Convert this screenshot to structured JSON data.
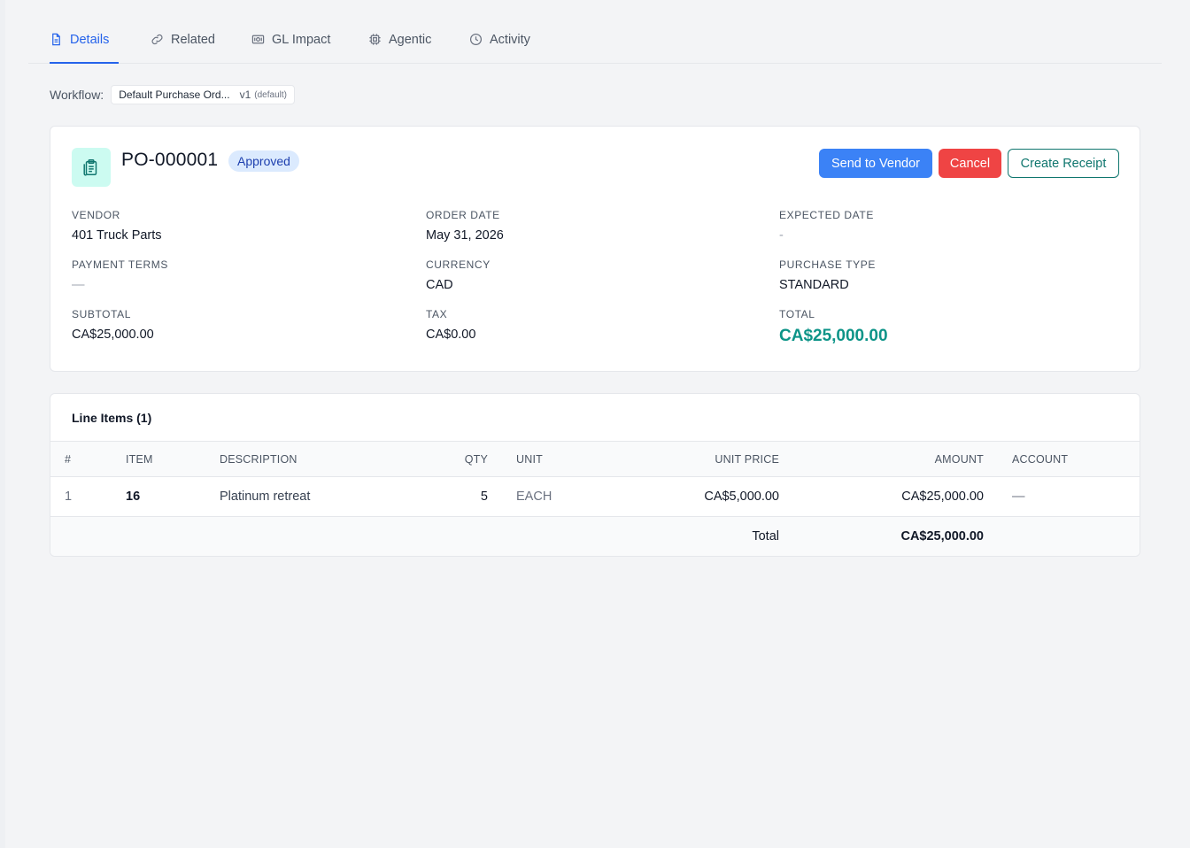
{
  "tabs": [
    {
      "label": "Details",
      "icon": "document-icon",
      "active": true
    },
    {
      "label": "Related",
      "icon": "link-icon",
      "active": false
    },
    {
      "label": "GL Impact",
      "icon": "banknote-icon",
      "active": false
    },
    {
      "label": "Agentic",
      "icon": "chip-icon",
      "active": false
    },
    {
      "label": "Activity",
      "icon": "clock-icon",
      "active": false
    }
  ],
  "workflow": {
    "label": "Workflow:",
    "name": "Default Purchase Ord...",
    "version": "v1",
    "default_tag": "(default)"
  },
  "po": {
    "number": "PO-000001",
    "status": "Approved",
    "icon": "clipboard-icon",
    "actions": {
      "send": "Send to Vendor",
      "cancel": "Cancel",
      "receipt": "Create Receipt"
    },
    "fields": {
      "vendor": {
        "label": "VENDOR",
        "value": "401 Truck Parts"
      },
      "order_date": {
        "label": "ORDER DATE",
        "value": "May 31, 2026"
      },
      "expected_date": {
        "label": "EXPECTED DATE",
        "value": "-"
      },
      "payment_terms": {
        "label": "PAYMENT TERMS",
        "value": "—"
      },
      "currency": {
        "label": "CURRENCY",
        "value": "CAD"
      },
      "purchase_type": {
        "label": "PURCHASE TYPE",
        "value": "STANDARD"
      },
      "subtotal": {
        "label": "SUBTOTAL",
        "value": "CA$25,000.00"
      },
      "tax": {
        "label": "TAX",
        "value": "CA$0.00"
      },
      "total": {
        "label": "TOTAL",
        "value": "CA$25,000.00"
      }
    }
  },
  "line_items": {
    "title": "Line Items (1)",
    "headers": {
      "num": "#",
      "item": "ITEM",
      "description": "DESCRIPTION",
      "qty": "QTY",
      "unit": "UNIT",
      "unit_price": "UNIT PRICE",
      "amount": "AMOUNT",
      "account": "ACCOUNT"
    },
    "rows": [
      {
        "num": "1",
        "item": "16",
        "description": "Platinum retreat",
        "qty": "5",
        "unit": "EACH",
        "unit_price": "CA$5,000.00",
        "amount": "CA$25,000.00",
        "account": "—"
      }
    ],
    "footer": {
      "label": "Total",
      "amount": "CA$25,000.00"
    }
  },
  "colors": {
    "accent": "#2563eb",
    "send_button": "#3b82f6",
    "cancel_button": "#ef4444",
    "receipt_button": "#0f766e",
    "total": "#0d9488",
    "status_badge_bg": "#dbeafe"
  }
}
